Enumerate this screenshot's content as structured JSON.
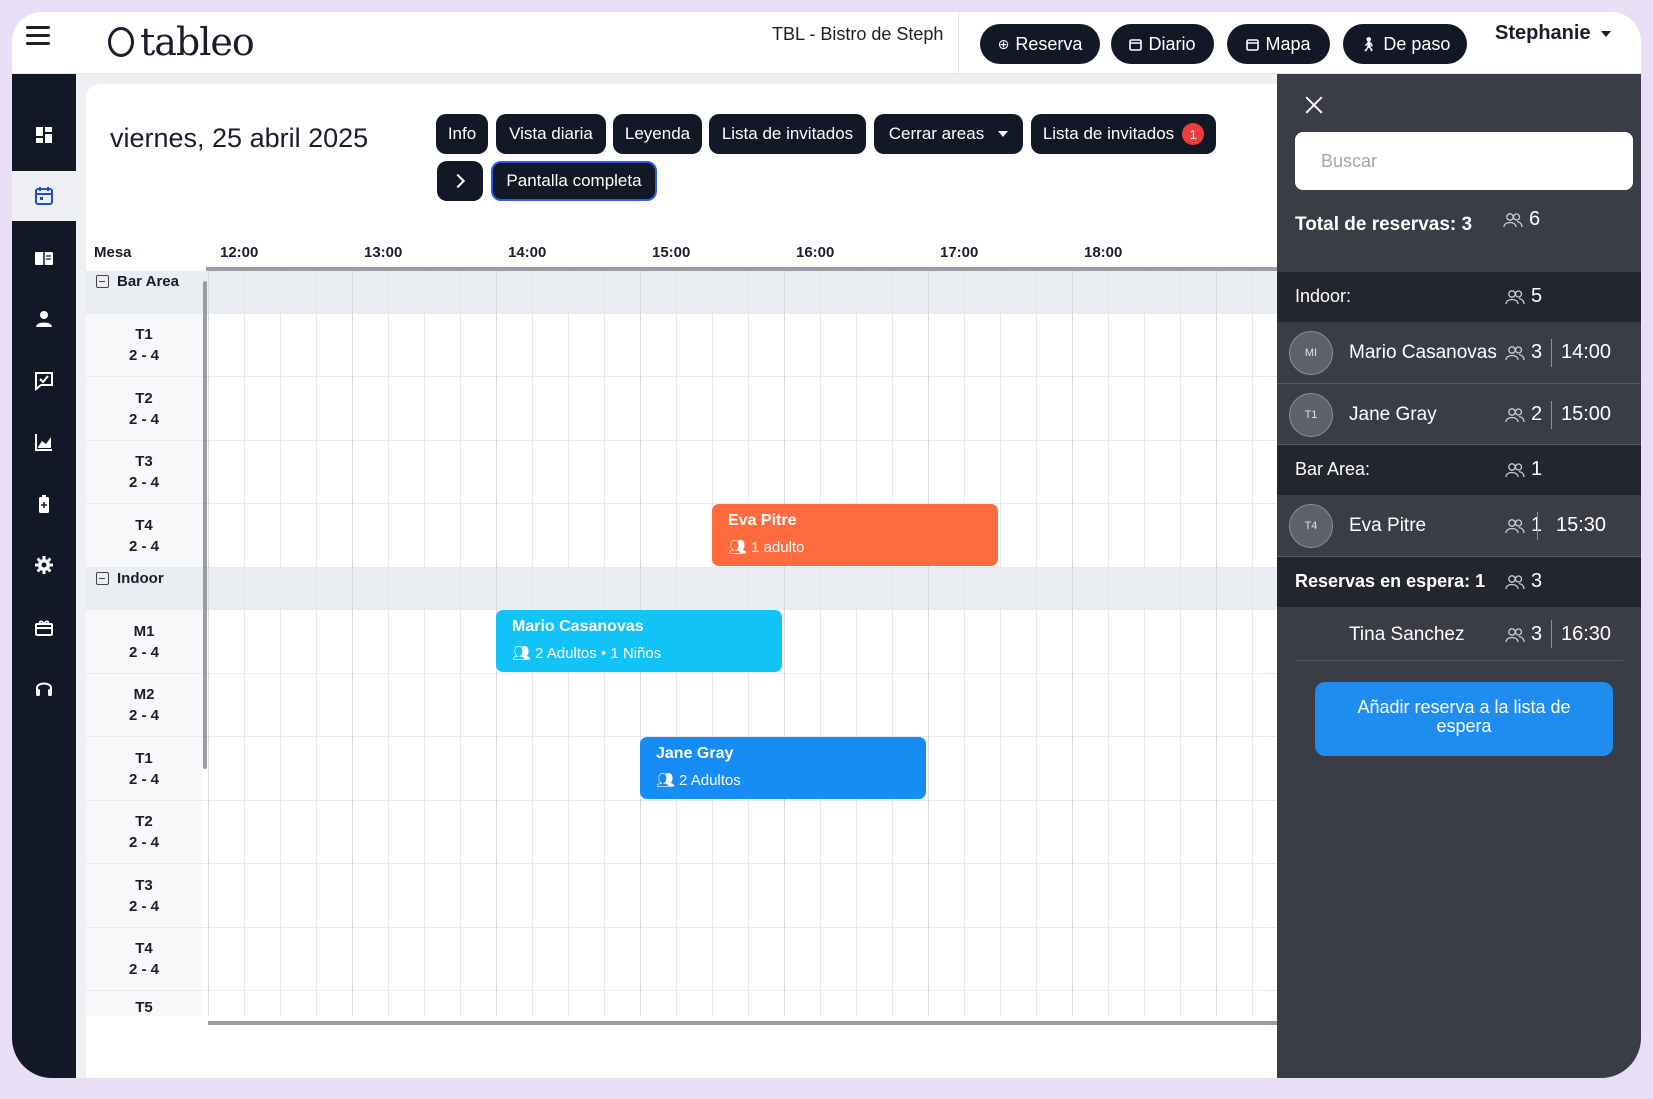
{
  "topbar": {
    "logo": "tableo",
    "venue": "TBL - Bistro de Steph",
    "buttons": {
      "reserva": "Reserva",
      "diario": "Diario",
      "mapa": "Mapa",
      "de_paso": "De paso"
    },
    "user": "Stephanie"
  },
  "sidebar": {
    "items": [
      "dashboard-icon",
      "calendar-icon",
      "book-icon",
      "user-icon",
      "feedback-icon",
      "chart-icon",
      "battery-icon",
      "gear-icon",
      "gift-icon",
      "headset-icon"
    ],
    "active": "calendar-icon"
  },
  "header": {
    "date": "viernes, 25 abril 2025",
    "actions": {
      "info": "Info",
      "vista_diaria": "Vista diaria",
      "leyenda": "Leyenda",
      "lista_invitados": "Lista de invitados",
      "cerrar_areas": "Cerrar areas",
      "lista_invitados_2": "Lista de invitados",
      "lista_badge": "1",
      "pantalla_completa": "Pantalla completa"
    }
  },
  "timeline": {
    "mesa_label": "Mesa",
    "hours": [
      "12:00",
      "13:00",
      "14:00",
      "15:00",
      "16:00",
      "17:00",
      "18:00"
    ],
    "sections": [
      {
        "name": "Bar Area",
        "tables": [
          {
            "name": "T1",
            "capacity": "2 - 4"
          },
          {
            "name": "T2",
            "capacity": "2 - 4"
          },
          {
            "name": "T3",
            "capacity": "2 - 4"
          },
          {
            "name": "T4",
            "capacity": "2 - 4"
          }
        ]
      },
      {
        "name": "Indoor",
        "tables": [
          {
            "name": "M1",
            "capacity": "2 - 4"
          },
          {
            "name": "M2",
            "capacity": "2 - 4"
          },
          {
            "name": "T1",
            "capacity": "2 - 4"
          },
          {
            "name": "T2",
            "capacity": "2 - 4"
          },
          {
            "name": "T3",
            "capacity": "2 - 4"
          },
          {
            "name": "T4",
            "capacity": "2 - 4"
          },
          {
            "name": "T5",
            "capacity": ""
          }
        ]
      }
    ],
    "bookings": [
      {
        "name": "Eva Pitre",
        "detail": "1 adulto",
        "start": "15:30",
        "color": "#ff6b3d"
      },
      {
        "name": "Mario Casanovas",
        "detail": "2 Adultos • 1 Niños",
        "start": "14:00",
        "color": "#11c3f7"
      },
      {
        "name": "Jane Gray",
        "detail": "2 Adultos",
        "start": "15:00",
        "color": "#168cf5"
      }
    ]
  },
  "panel": {
    "search_placeholder": "Buscar",
    "total_label": "Total de reservas: 3",
    "total_people": "6",
    "groups": [
      {
        "name": "Indoor:",
        "people": "5",
        "rows": [
          {
            "initials": "MI",
            "name": "Mario Casanovas",
            "people": "3",
            "time": "14:00"
          },
          {
            "initials": "T1",
            "name": "Jane Gray",
            "people": "2",
            "time": "15:00"
          }
        ]
      },
      {
        "name": "Bar Area:",
        "people": "1",
        "rows": [
          {
            "initials": "T4",
            "name": "Eva Pitre",
            "people": "1",
            "time": "15:30"
          }
        ]
      }
    ],
    "waitlist": {
      "label": "Reservas en espera: 1",
      "people": "3",
      "rows": [
        {
          "name": "Tina Sanchez",
          "people": "3",
          "time": "16:30"
        }
      ]
    },
    "add_waitlist_button": "Añadir reserva a la lista de espera"
  }
}
